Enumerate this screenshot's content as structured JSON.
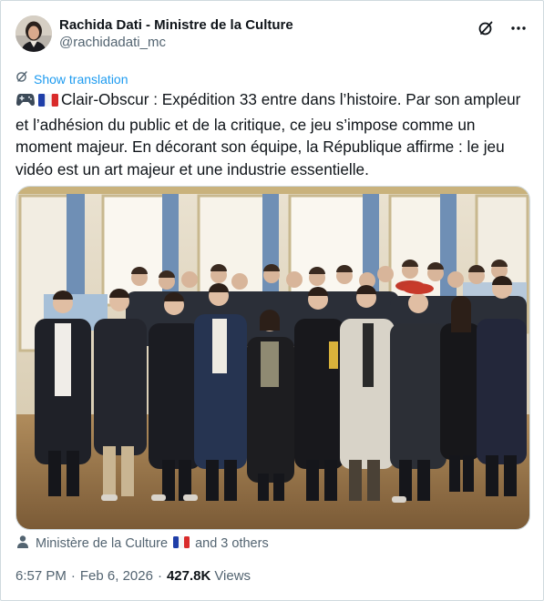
{
  "author": {
    "display_name": "Rachida Dati - Ministre de la Culture",
    "handle": "@rachidadati_mc"
  },
  "translate": {
    "label": "Show translation"
  },
  "tweet": {
    "emojis": [
      "game-controller-icon",
      "flag-france-icon"
    ],
    "lines": [
      "Clair-Obscur : Expédition 33 entre dans l’histoire. Par son ampleur",
      "et l’adhésion du public et de la critique, ce jeu s’impose comme un",
      "moment majeur. En décorant son équipe, la République affirme : le jeu",
      "vidéo est un art majeur et une industrie essentielle."
    ]
  },
  "tagged": {
    "primary": "Ministère de la Culture",
    "others": "and 3 others"
  },
  "meta": {
    "time": "6:57 PM",
    "date": "Feb 6, 2026",
    "views_count": "427.8K",
    "views_label": "Views"
  },
  "colors": {
    "link": "#1d9bf0",
    "secondary_text": "#536471",
    "border": "#cfd9de"
  }
}
